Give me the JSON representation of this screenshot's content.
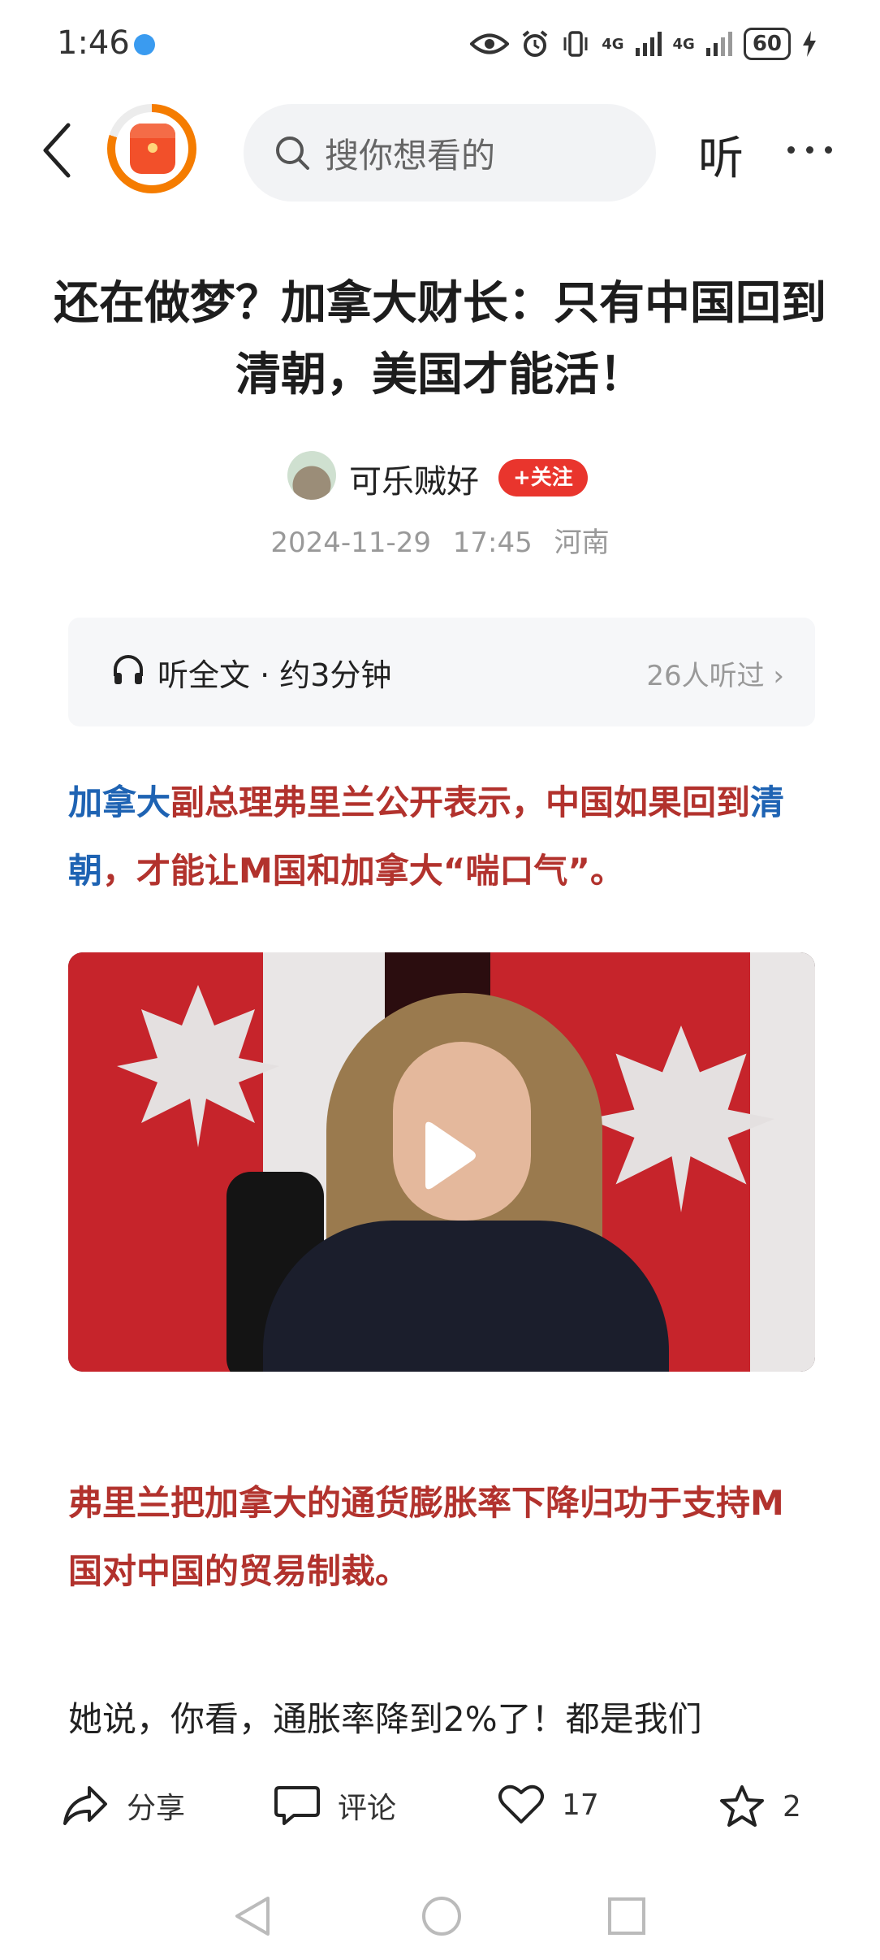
{
  "status": {
    "time": "1:46",
    "network1": "4G",
    "network2": "4G",
    "battery": "60"
  },
  "nav": {
    "search_placeholder": "搜你想看的",
    "listen_label": "听"
  },
  "article": {
    "title": "还在做梦？加拿大财长：只有中国回到清朝，美国才能活！",
    "author": "可乐贼好",
    "follow_label": "+关注",
    "date": "2024-11-29",
    "time": "17:45",
    "location": "河南",
    "listen_bar": {
      "label": "听全文 · 约3分钟",
      "count": "26人听过 ›"
    },
    "p1": {
      "link1": "加拿大",
      "text1": "副总理弗里兰公开表示，中国如果回到",
      "link2": "清朝",
      "text2": "，才能让M国和加拿大“喘口气”。"
    },
    "p2": "弗里兰把加拿大的通货膨胀率下降归功于支持M国对中国的贸易制裁。",
    "p3": "她说，你看，通胀率降到2%了！都是我们"
  },
  "actions": {
    "share": "分享",
    "comment": "评论",
    "likes": "17",
    "favorites": "2"
  },
  "colors": {
    "accent_red": "#e9352d",
    "text_red": "#b2322d",
    "link_blue": "#1e63b3",
    "logo_orange": "#f57c00"
  }
}
